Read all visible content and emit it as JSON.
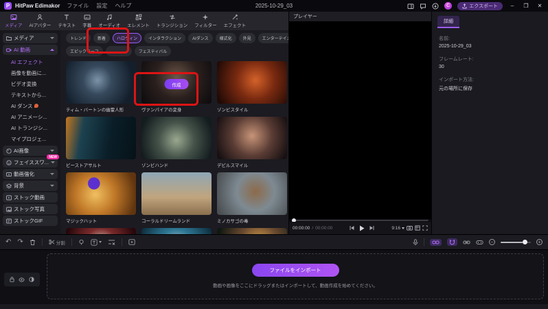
{
  "titlebar": {
    "app_name": "HitPaw Edimakor",
    "menu_file": "ファイル",
    "menu_settings": "設定",
    "menu_help": "ヘルプ",
    "project_title": "2025-10-29_03",
    "export_label": "エクスポート",
    "avatar_letter": "C",
    "minimize": "–",
    "maximize": "❐",
    "close": "✕"
  },
  "tabs": {
    "media": "メディア",
    "ai_avatar": "AIアバター",
    "text": "テキスト",
    "subtitle": "字幕",
    "audio": "オーディオ",
    "element": "エレメント",
    "transition": "トランジション",
    "filter": "フィルター",
    "effect": "エフェクト"
  },
  "sidebar": {
    "media_group": "メディア",
    "ai_video_group": "AI 動画",
    "sub": [
      "AI エフェクト",
      "画像を動画に...",
      "ビデオ変換",
      "テキストから...",
      "AI ダンス",
      "AI アニメーシ...",
      "AI トランジシ...",
      "マイプロジェ..."
    ],
    "groups": [
      "AI画像",
      "フェイススワ...",
      "動画強化",
      "背景",
      "ストック動画",
      "ストック写真",
      "ストックGIF"
    ],
    "new_badge": "NEW"
  },
  "chips": {
    "row1": [
      "トレンド",
      "新着",
      "ハロウィン",
      "インタラクション",
      "AIダンス",
      "様式化",
      "外見",
      "エンターテイメント"
    ],
    "row2": [
      "エピックモーフ",
      "",
      "フェスティバル"
    ],
    "selected": "ハロウィン"
  },
  "effects": {
    "create_label": "作成",
    "cards": [
      "ティム・バートンの幽霊人形",
      "ヴァンパイアの変身",
      "ゾンビスタイル",
      "ビーストアサルト",
      "ゾンビハンド",
      "デビルスマイル",
      "マジックハット",
      "コーラルドリームランド",
      "ミノカサゴの毒",
      "",
      "",
      ""
    ]
  },
  "player": {
    "title": "プレイヤー",
    "current_time": "00:00:00",
    "separator": "/",
    "total_time": "00:00:00",
    "aspect": "9:16"
  },
  "details": {
    "tab": "詳細",
    "name_label": "名前:",
    "name_value": "2025-10-29_03",
    "fps_label": "フレームレート:",
    "fps_value": "30",
    "import_label": "インポート方法:",
    "import_value": "元の場所に保存"
  },
  "toolbar": {
    "split_label": "分割",
    "undo": "↶",
    "redo": "↷",
    "text_tool": "T"
  },
  "import_zone": {
    "button_label": "ファイルをインポート",
    "hint": "動画や画像をここにドラッグまたはインポートして、動画作成を始めてください。"
  },
  "colors": {
    "accent": "#9b5cf6",
    "annotation": "#dd1414",
    "badge": "#ff2ea6"
  }
}
